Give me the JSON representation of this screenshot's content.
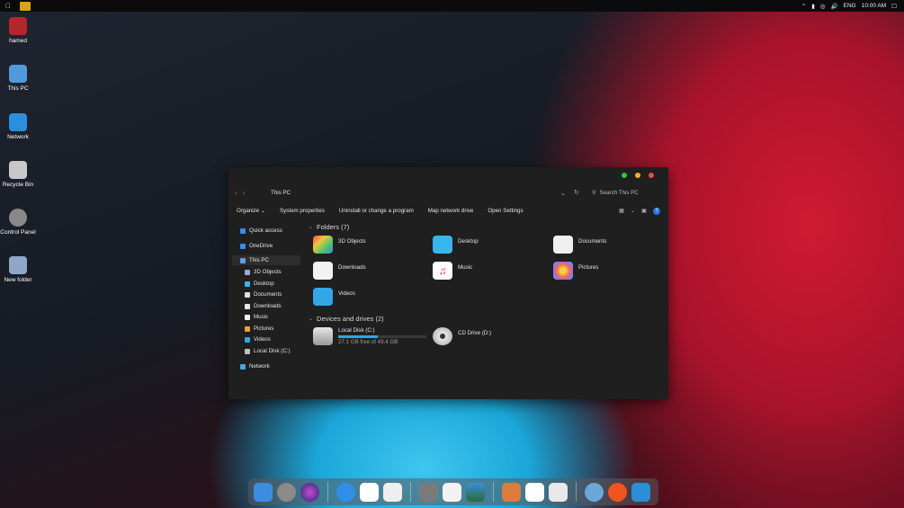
{
  "menubar": {
    "apple_icon": "apple-icon",
    "tray": {
      "lang": "ENG",
      "time": "10:00 AM"
    }
  },
  "desktop": [
    {
      "label": "hamed",
      "icon": "user-icon",
      "color": "#b5252c"
    },
    {
      "label": "This PC",
      "icon": "finder-icon",
      "color": "#4f9ad8"
    },
    {
      "label": "Network",
      "icon": "wifi-icon",
      "color": "#2b8fe0"
    },
    {
      "label": "Recycle Bin",
      "icon": "trash-icon",
      "color": "#c8c8c8"
    },
    {
      "label": "Control Panel",
      "icon": "settings-icon",
      "color": "#888888"
    },
    {
      "label": "New folder",
      "icon": "folder-icon",
      "color": "#8fa6c8"
    }
  ],
  "window": {
    "breadcrumb": "This PC",
    "search_placeholder": "Search This PC",
    "toolbar": {
      "organize": "Organize",
      "system_properties": "System properties",
      "uninstall": "Uninstall or change a program",
      "map_drive": "Map network drive",
      "open_settings": "Open Settings"
    },
    "nav": {
      "quick_access": "Quick access",
      "onedrive": "OneDrive",
      "this_pc": "This PC",
      "items": [
        "3D Objects",
        "Desktop",
        "Documents",
        "Downloads",
        "Music",
        "Pictures",
        "Videos",
        "Local Disk (C:)"
      ],
      "network": "Network"
    },
    "folders_header": "Folders (7)",
    "folders": [
      {
        "label": "3D Objects",
        "color": "#e8e8e8"
      },
      {
        "label": "Desktop",
        "color": "#36b6ec"
      },
      {
        "label": "Documents",
        "color": "#efefef"
      },
      {
        "label": "Downloads",
        "color": "#f2f2f2"
      },
      {
        "label": "Music",
        "color": "#ffffff"
      },
      {
        "label": "Pictures",
        "color": "#ffffff"
      },
      {
        "label": "Videos",
        "color": "#32a6e6"
      }
    ],
    "drives_header": "Devices and drives (2)",
    "drives": [
      {
        "label": "Local Disk (C:)",
        "free": "27.1 GB free of 49.4 GB",
        "used_fraction": 0.45
      },
      {
        "label": "CD Drive (D:)"
      }
    ]
  }
}
